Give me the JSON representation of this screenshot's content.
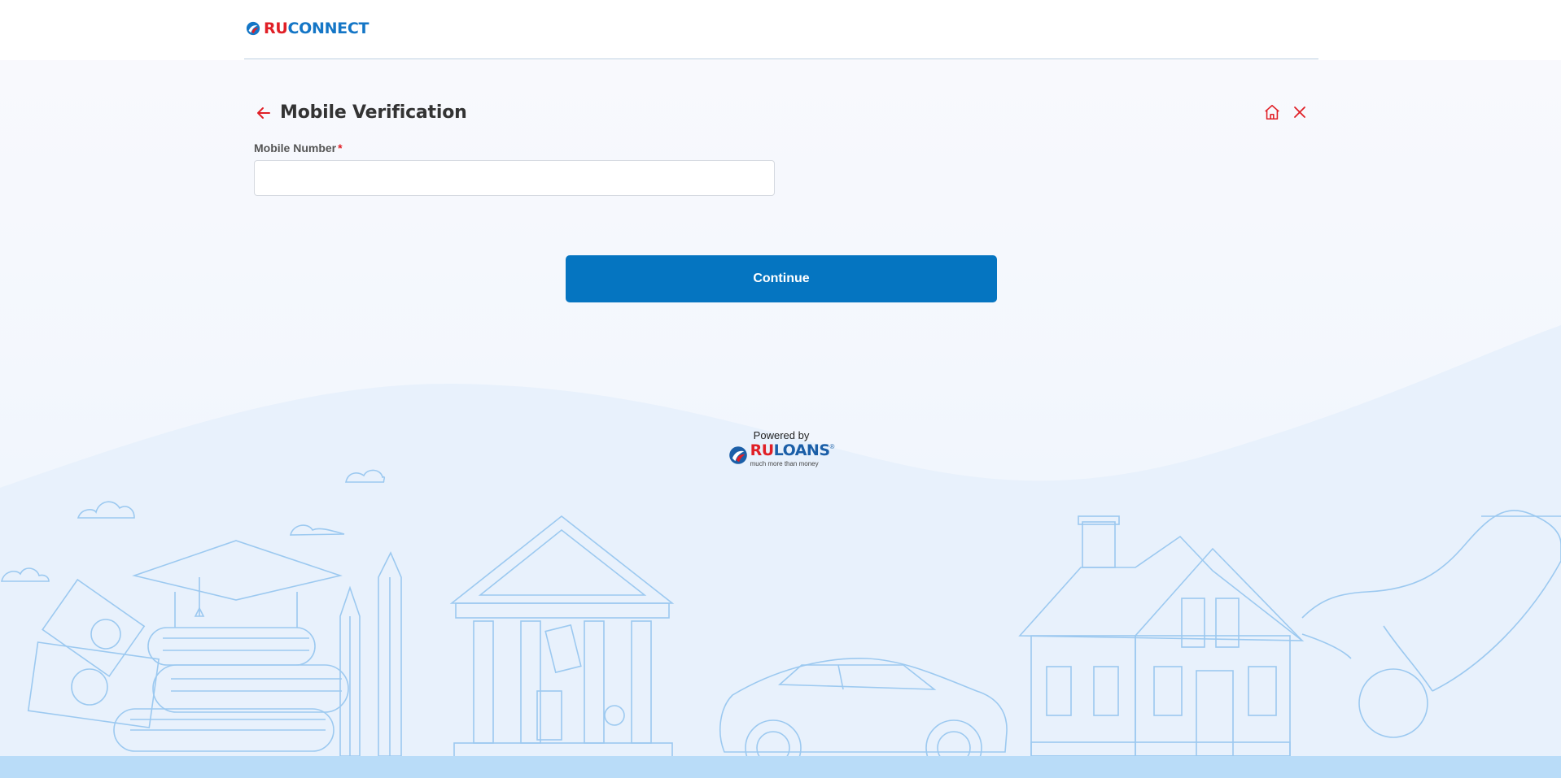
{
  "brand": {
    "logo_ru": "RU",
    "logo_connect": "CONNECT",
    "accent_red": "#e01f26",
    "accent_blue": "#1476c6"
  },
  "header": {
    "title": "Mobile Verification",
    "back_icon": "arrow-left-icon",
    "home_icon": "home-icon",
    "close_icon": "close-icon"
  },
  "form": {
    "mobile_label": "Mobile Number",
    "required_mark": "*",
    "mobile_value": "",
    "mobile_placeholder": ""
  },
  "actions": {
    "continue_label": "Continue",
    "button_color": "#0575c1"
  },
  "footer": {
    "powered_by": "Powered by",
    "ruloans_ru": "RU",
    "ruloans_loans": "LOANS",
    "registered": "®",
    "tagline": "much more than money"
  }
}
